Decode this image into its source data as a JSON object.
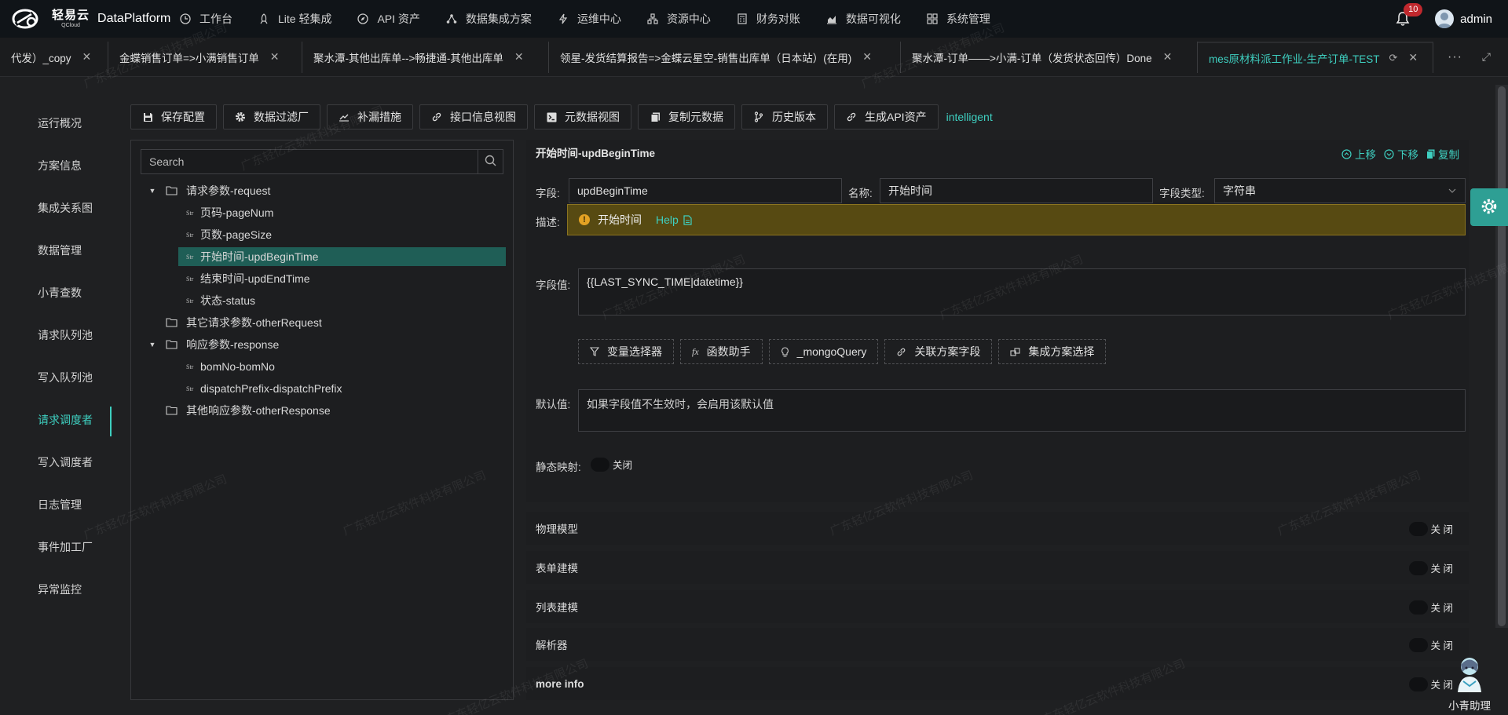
{
  "brand": {
    "logo_text": "轻易云",
    "logo_sub": "QCloud",
    "app_name": "DataPlatform"
  },
  "topnav": {
    "items": [
      {
        "label": "工作台",
        "icon": "clock-icon"
      },
      {
        "label": "Lite 轻集成",
        "icon": "rocket-icon"
      },
      {
        "label": "API 资产",
        "icon": "compass-icon"
      },
      {
        "label": "数据集成方案",
        "icon": "network-icon"
      },
      {
        "label": "运维中心",
        "icon": "lightning-icon"
      },
      {
        "label": "资源中心",
        "icon": "cluster-icon"
      },
      {
        "label": "财务对账",
        "icon": "calculator-icon"
      },
      {
        "label": "数据可视化",
        "icon": "chart-icon"
      },
      {
        "label": "系统管理",
        "icon": "grid-icon"
      }
    ],
    "notification_count": "10",
    "username": "admin"
  },
  "tabs": [
    {
      "label": "代发）_copy",
      "active": false
    },
    {
      "label": "金蝶销售订单=>小满销售订单",
      "active": false
    },
    {
      "label": "聚水潭-其他出库单-->畅捷通-其他出库单",
      "active": false
    },
    {
      "label": "领星-发货结算报告=>金蝶云星空-销售出库单（日本站）(在用)",
      "active": false
    },
    {
      "label": "聚水潭-订单——>小满-订单（发货状态回传）Done",
      "active": false
    },
    {
      "label": "mes原材料派工作业-生产订单-TEST",
      "active": true
    }
  ],
  "tab_more": "···",
  "sidemenu": [
    {
      "label": "运行概况",
      "active": false
    },
    {
      "label": "方案信息",
      "active": false
    },
    {
      "label": "集成关系图",
      "active": false
    },
    {
      "label": "数据管理",
      "active": false
    },
    {
      "label": "小青查数",
      "active": false
    },
    {
      "label": "请求队列池",
      "active": false
    },
    {
      "label": "写入队列池",
      "active": false
    },
    {
      "label": "请求调度者",
      "active": true
    },
    {
      "label": "写入调度者",
      "active": false
    },
    {
      "label": "日志管理",
      "active": false
    },
    {
      "label": "事件加工厂",
      "active": false
    },
    {
      "label": "异常监控",
      "active": false
    }
  ],
  "toolbar": {
    "buttons": [
      {
        "label": "保存配置",
        "icon": "save-icon"
      },
      {
        "label": "数据过滤厂",
        "icon": "gear-icon"
      },
      {
        "label": "补漏措施",
        "icon": "trend-icon"
      },
      {
        "label": "接口信息视图",
        "icon": "link-icon"
      },
      {
        "label": "元数据视图",
        "icon": "code-icon"
      },
      {
        "label": "复制元数据",
        "icon": "copy-icon"
      },
      {
        "label": "历史版本",
        "icon": "branch-icon"
      },
      {
        "label": "生成API资产",
        "icon": "link-icon"
      }
    ],
    "link": "intelligent"
  },
  "tree": {
    "search_placeholder": "Search",
    "nodes": [
      {
        "label": "请求参数-request",
        "type": "folder",
        "level": 0,
        "expanded": true
      },
      {
        "label": "页码-pageNum",
        "type": "str",
        "level": 1
      },
      {
        "label": "页数-pageSize",
        "type": "str",
        "level": 1
      },
      {
        "label": "开始时间-updBeginTime",
        "type": "str",
        "level": 1,
        "selected": true
      },
      {
        "label": "结束时间-updEndTime",
        "type": "str",
        "level": 1
      },
      {
        "label": "状态-status",
        "type": "str",
        "level": 1
      },
      {
        "label": "其它请求参数-otherRequest",
        "type": "folder",
        "level": 0,
        "expanded": false
      },
      {
        "label": "响应参数-response",
        "type": "folder",
        "level": 0,
        "expanded": true
      },
      {
        "label": "bomNo-bomNo",
        "type": "str",
        "level": 1
      },
      {
        "label": "dispatchPrefix-dispatchPrefix",
        "type": "str",
        "level": 1
      },
      {
        "label": "其他响应参数-otherResponse",
        "type": "folder",
        "level": 0,
        "expanded": false
      }
    ],
    "str_tag": "Str"
  },
  "detail": {
    "title": "开始时间-updBeginTime",
    "actions": {
      "up": "上移",
      "down": "下移",
      "copy": "复制"
    },
    "field_label": "字段:",
    "field_value": "updBeginTime",
    "name_label": "名称:",
    "name_value": "开始时间",
    "type_label": "字段类型:",
    "type_value": "字符串",
    "desc_label": "描述:",
    "desc_value": "开始时间",
    "desc_help": "Help",
    "value_label": "字段值:",
    "value_text": "{{LAST_SYNC_TIME|datetime}}",
    "helpers": [
      {
        "label": "变量选择器",
        "icon": "filter-icon"
      },
      {
        "label": "函数助手",
        "icon": "fx-icon"
      },
      {
        "label": "_mongoQuery",
        "icon": "bulb-icon"
      },
      {
        "label": "关联方案字段",
        "icon": "link-icon"
      },
      {
        "label": "集成方案选择",
        "icon": "blocks-icon"
      }
    ],
    "default_label": "默认值:",
    "default_placeholder": "如果字段值不生效时，会启用该默认值",
    "static_label": "静态映射:",
    "static_state": "关闭"
  },
  "sections": [
    {
      "label": "物理模型",
      "state": "关 闭",
      "bold": false
    },
    {
      "label": "表单建模",
      "state": "关 闭",
      "bold": false
    },
    {
      "label": "列表建模",
      "state": "关 闭",
      "bold": false
    },
    {
      "label": "解析器",
      "state": "关 闭",
      "bold": false
    },
    {
      "label": "more info",
      "state": "关 闭",
      "bold": true
    }
  ],
  "assistant": {
    "label": "小青助理"
  },
  "watermark": "广东轻亿云软件科技有限公司",
  "colors": {
    "accent": "#3ecfc0",
    "selected_bg": "#1f5e56",
    "warning_bg": "#574a12",
    "badge": "#c0282d"
  }
}
